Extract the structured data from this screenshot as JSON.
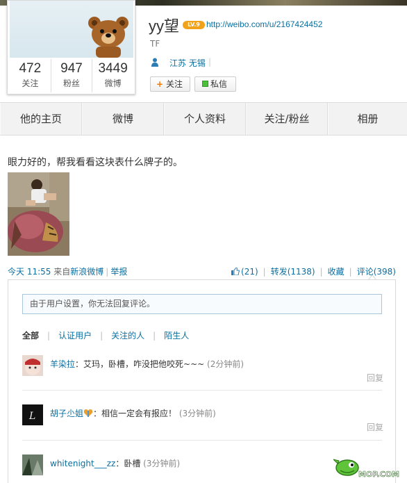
{
  "profile": {
    "name": "yy望",
    "level_badge": "LV.9",
    "url": "http://weibo.com/u/2167424452",
    "tag": "TF",
    "location": "江苏 无锡",
    "stats": [
      {
        "num": "472",
        "label": "关注"
      },
      {
        "num": "947",
        "label": "粉丝"
      },
      {
        "num": "3449",
        "label": "微博"
      }
    ],
    "follow_label": "关注",
    "follow_icon": "+",
    "message_label": "私信"
  },
  "nav": {
    "tabs": [
      "他的主页",
      "微博",
      "个人资料",
      "关注/粉丝",
      "相册"
    ]
  },
  "post": {
    "text": "眼力好的，帮我看看这块表什么牌子的。",
    "time": "今天 11:55",
    "source_prefix": "来自",
    "source": "新浪微博",
    "report": "举报",
    "like": "(21)",
    "repost": "转发(1138)",
    "favorite": "收藏",
    "comment": "评论(398)"
  },
  "comments": {
    "notice": "由于用户设置，你无法回复评论。",
    "filters": [
      "全部",
      "认证用户",
      "关注的人",
      "陌生人"
    ],
    "reply_label": "回复",
    "items": [
      {
        "user": "羊染拉",
        "text": "：艾玛，卧槽，咋没把他咬死~~~",
        "time": "(2分钟前)"
      },
      {
        "user": "胡子尐姐",
        "text": "：相信一定会有报应！",
        "time": "(3分钟前)"
      },
      {
        "user": "whitenight___zz",
        "text": "：卧槽",
        "time": "(3分钟前)"
      }
    ]
  },
  "watermark": "MOP.COM",
  "colors": {
    "link": "#0a6fa0",
    "badge": "#f2a11a",
    "follow_plus": "#f07800",
    "msg_green": "#4bbf3a"
  }
}
